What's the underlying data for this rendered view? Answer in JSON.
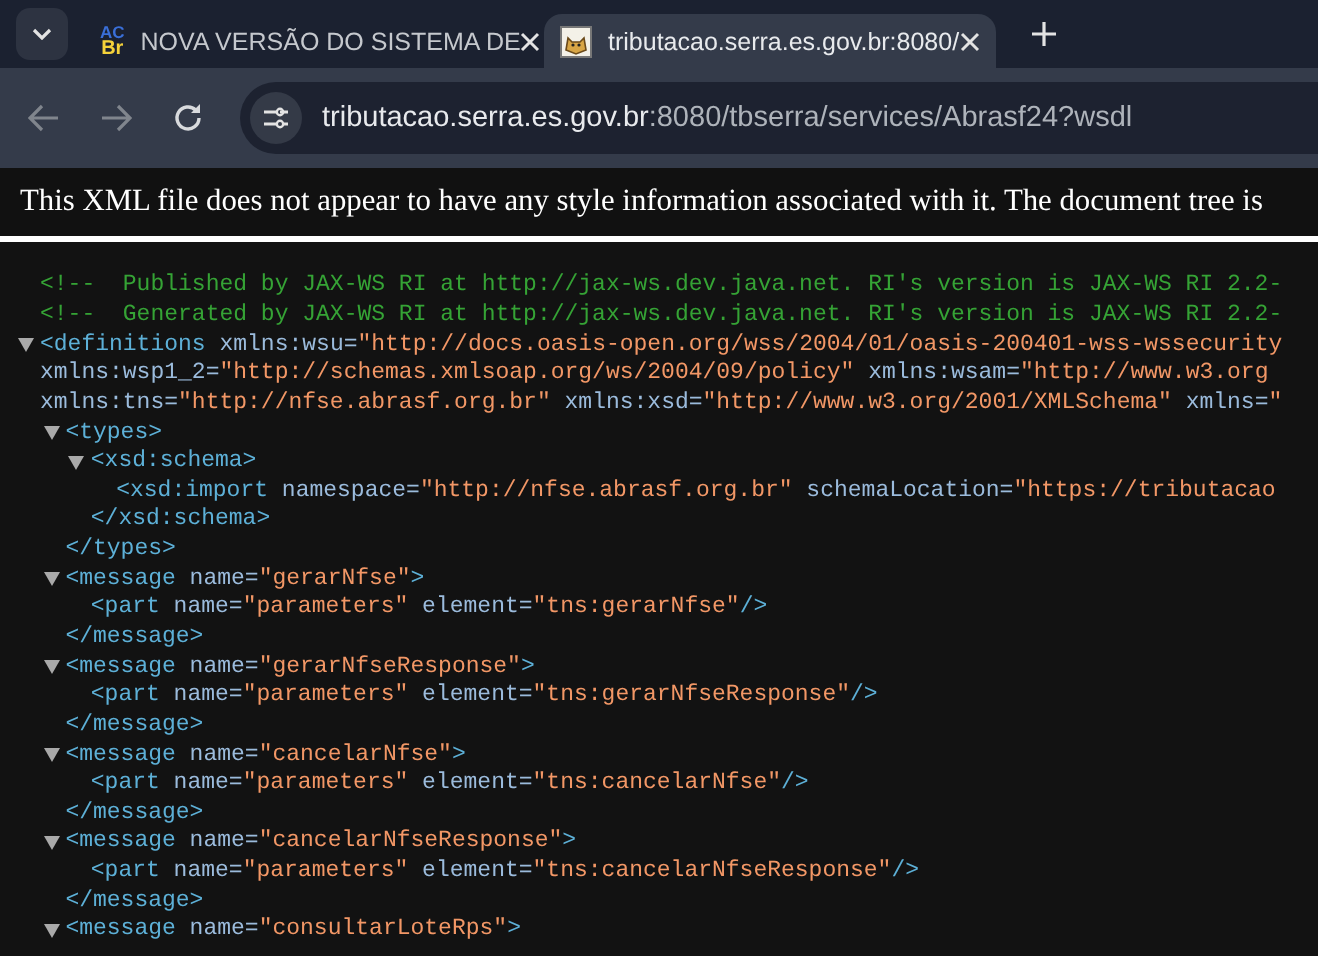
{
  "tabs": [
    {
      "title": "NOVA VERSÃO DO SISTEMA DE",
      "favicon_text": [
        "AC",
        "Br"
      ],
      "selected": false
    },
    {
      "title": "tributacao.serra.es.gov.br:8080/",
      "selected": true
    }
  ],
  "toolbar": {
    "url_host": "tributacao.serra.es.gov.br",
    "url_path": ":8080/tbserra/services/Abrasf24?wsdl"
  },
  "info_message": "This XML file does not appear to have any style information associated with it. The document tree is",
  "xml": {
    "comments": [
      "<!--  Published by JAX-WS RI at http://jax-ws.dev.java.net. RI's version is JAX-WS RI 2.2-",
      "<!--  Generated by JAX-WS RI at http://jax-ws.dev.java.net. RI's version is JAX-WS RI 2.2-"
    ],
    "root": {
      "expanded": true,
      "open": [
        [
          {
            "kind": "tag",
            "text": "<definitions"
          },
          {
            "kind": "attr",
            "text": " xmlns:wsu="
          },
          {
            "kind": "value",
            "text": "\"http://docs.oasis-open.org/wss/2004/01/oasis-200401-wss-wssecurity"
          }
        ],
        [
          {
            "kind": "attr",
            "text": "xmlns:wsp1_2="
          },
          {
            "kind": "value",
            "text": "\"http://schemas.xmlsoap.org/ws/2004/09/policy\""
          },
          {
            "kind": "attr",
            "text": " xmlns:wsam="
          },
          {
            "kind": "value",
            "text": "\"http://www.w3.org"
          }
        ],
        [
          {
            "kind": "attr",
            "text": "xmlns:tns="
          },
          {
            "kind": "value",
            "text": "\"http://nfse.abrasf.org.br\""
          },
          {
            "kind": "attr",
            "text": " xmlns:xsd="
          },
          {
            "kind": "value",
            "text": "\"http://www.w3.org/2001/XMLSchema\""
          },
          {
            "kind": "attr",
            "text": " xmlns="
          },
          {
            "kind": "value",
            "text": "\""
          }
        ]
      ],
      "children": [
        {
          "expanded": true,
          "open": [
            [
              {
                "kind": "tag",
                "text": "<types>"
              }
            ]
          ],
          "children": [
            {
              "expanded": true,
              "open": [
                [
                  {
                    "kind": "tag",
                    "text": "<xsd:schema>"
                  }
                ]
              ],
              "children": [
                {
                  "open": [
                    [
                      {
                        "kind": "tag",
                        "text": "<xsd:import"
                      },
                      {
                        "kind": "attr",
                        "text": " namespace="
                      },
                      {
                        "kind": "value",
                        "text": "\"http://nfse.abrasf.org.br\""
                      },
                      {
                        "kind": "attr",
                        "text": " schemaLocation="
                      },
                      {
                        "kind": "value",
                        "text": "\"https://tributacao"
                      }
                    ]
                  ]
                }
              ],
              "close": [
                {
                  "kind": "tag",
                  "text": "</xsd:schema>"
                }
              ]
            }
          ],
          "close": [
            {
              "kind": "tag",
              "text": "</types>"
            }
          ]
        },
        {
          "expanded": true,
          "open": [
            [
              {
                "kind": "tag",
                "text": "<message"
              },
              {
                "kind": "attr",
                "text": " name="
              },
              {
                "kind": "value",
                "text": "\"gerarNfse\""
              },
              {
                "kind": "tag",
                "text": ">"
              }
            ]
          ],
          "children": [
            {
              "open": [
                [
                  {
                    "kind": "tag",
                    "text": "<part"
                  },
                  {
                    "kind": "attr",
                    "text": " name="
                  },
                  {
                    "kind": "value",
                    "text": "\"parameters\""
                  },
                  {
                    "kind": "attr",
                    "text": " element="
                  },
                  {
                    "kind": "value",
                    "text": "\"tns:gerarNfse\""
                  },
                  {
                    "kind": "tag",
                    "text": "/>"
                  }
                ]
              ]
            }
          ],
          "close": [
            {
              "kind": "tag",
              "text": "</message>"
            }
          ]
        },
        {
          "expanded": true,
          "open": [
            [
              {
                "kind": "tag",
                "text": "<message"
              },
              {
                "kind": "attr",
                "text": " name="
              },
              {
                "kind": "value",
                "text": "\"gerarNfseResponse\""
              },
              {
                "kind": "tag",
                "text": ">"
              }
            ]
          ],
          "children": [
            {
              "open": [
                [
                  {
                    "kind": "tag",
                    "text": "<part"
                  },
                  {
                    "kind": "attr",
                    "text": " name="
                  },
                  {
                    "kind": "value",
                    "text": "\"parameters\""
                  },
                  {
                    "kind": "attr",
                    "text": " element="
                  },
                  {
                    "kind": "value",
                    "text": "\"tns:gerarNfseResponse\""
                  },
                  {
                    "kind": "tag",
                    "text": "/>"
                  }
                ]
              ]
            }
          ],
          "close": [
            {
              "kind": "tag",
              "text": "</message>"
            }
          ]
        },
        {
          "expanded": true,
          "open": [
            [
              {
                "kind": "tag",
                "text": "<message"
              },
              {
                "kind": "attr",
                "text": " name="
              },
              {
                "kind": "value",
                "text": "\"cancelarNfse\""
              },
              {
                "kind": "tag",
                "text": ">"
              }
            ]
          ],
          "children": [
            {
              "open": [
                [
                  {
                    "kind": "tag",
                    "text": "<part"
                  },
                  {
                    "kind": "attr",
                    "text": " name="
                  },
                  {
                    "kind": "value",
                    "text": "\"parameters\""
                  },
                  {
                    "kind": "attr",
                    "text": " element="
                  },
                  {
                    "kind": "value",
                    "text": "\"tns:cancelarNfse\""
                  },
                  {
                    "kind": "tag",
                    "text": "/>"
                  }
                ]
              ]
            }
          ],
          "close": [
            {
              "kind": "tag",
              "text": "</message>"
            }
          ]
        },
        {
          "expanded": true,
          "open": [
            [
              {
                "kind": "tag",
                "text": "<message"
              },
              {
                "kind": "attr",
                "text": " name="
              },
              {
                "kind": "value",
                "text": "\"cancelarNfseResponse\""
              },
              {
                "kind": "tag",
                "text": ">"
              }
            ]
          ],
          "children": [
            {
              "open": [
                [
                  {
                    "kind": "tag",
                    "text": "<part"
                  },
                  {
                    "kind": "attr",
                    "text": " name="
                  },
                  {
                    "kind": "value",
                    "text": "\"parameters\""
                  },
                  {
                    "kind": "attr",
                    "text": " element="
                  },
                  {
                    "kind": "value",
                    "text": "\"tns:cancelarNfseResponse\""
                  },
                  {
                    "kind": "tag",
                    "text": "/>"
                  }
                ]
              ]
            }
          ],
          "close": [
            {
              "kind": "tag",
              "text": "</message>"
            }
          ]
        },
        {
          "expanded": true,
          "open": [
            [
              {
                "kind": "tag",
                "text": "<message"
              },
              {
                "kind": "attr",
                "text": " name="
              },
              {
                "kind": "value",
                "text": "\"consultarLoteRps\""
              },
              {
                "kind": "tag",
                "text": ">"
              }
            ]
          ]
        }
      ]
    }
  }
}
